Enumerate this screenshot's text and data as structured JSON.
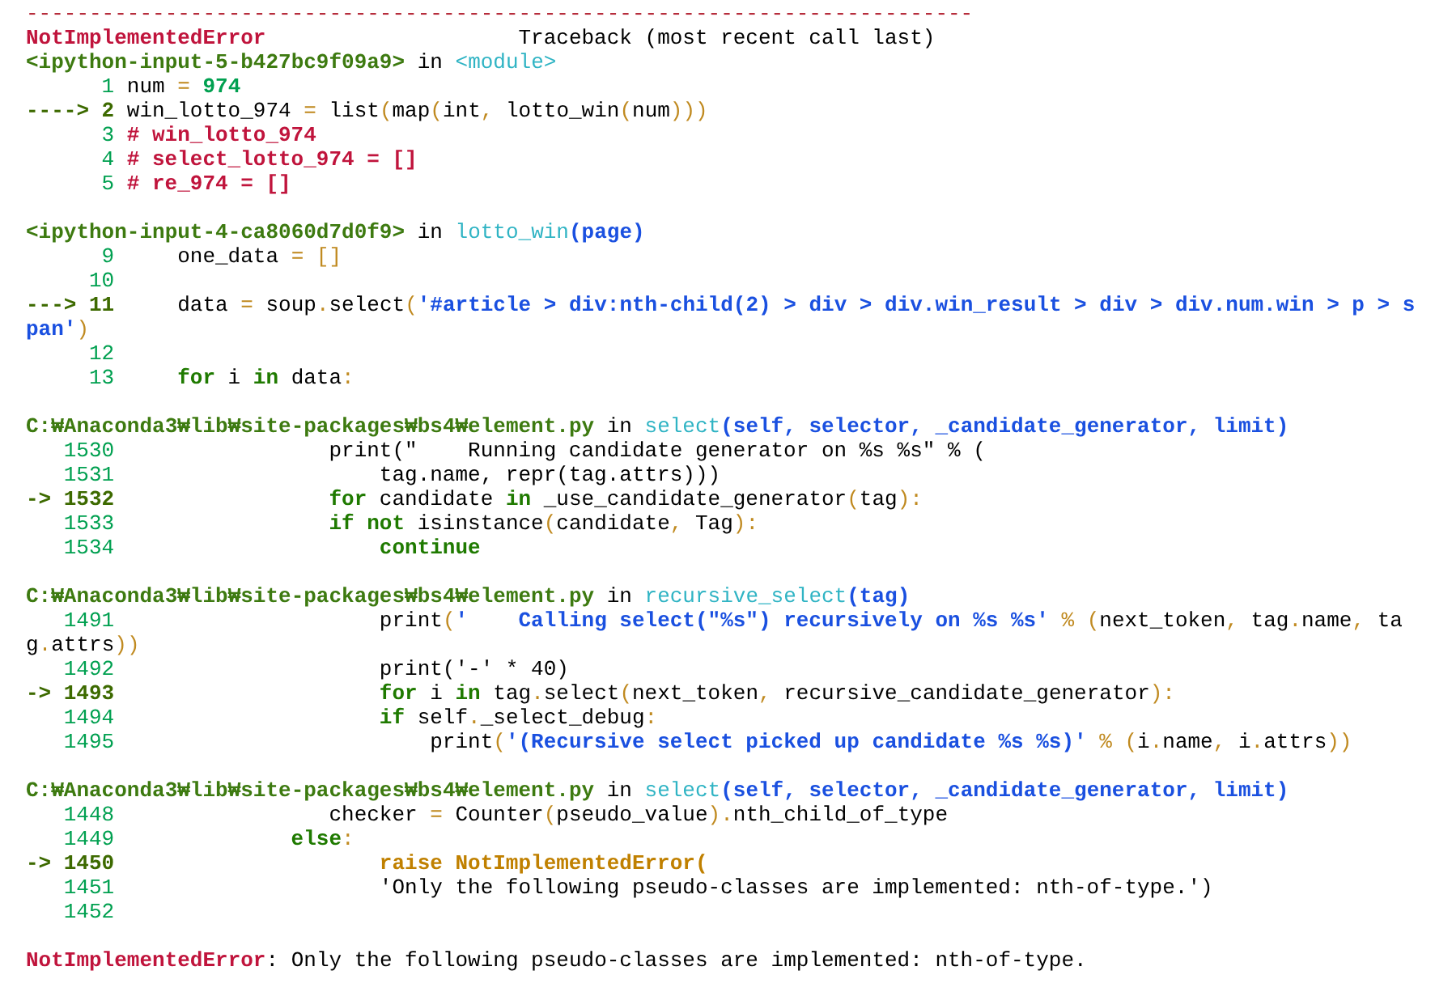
{
  "separator": "---------------------------------------------------------------------------",
  "error_header": {
    "name": "NotImplementedError",
    "traceback": "Traceback (most recent call last)"
  },
  "frames": [
    {
      "location": [
        {
          "kind": "path",
          "text": "<ipython-input-5-b427bc9f09a9>"
        },
        {
          "kind": "plain",
          "text": " in "
        },
        {
          "kind": "name",
          "text": "<module>"
        }
      ],
      "lines": [
        {
          "number": "1",
          "current": false,
          "code": [
            {
              "kind": "plain",
              "text": "num "
            },
            {
              "kind": "op",
              "text": "="
            },
            {
              "kind": "num",
              "text": " 974"
            }
          ]
        },
        {
          "arrow": "---->",
          "number": "2",
          "current": true,
          "code": [
            {
              "kind": "plain",
              "text": "win_lotto_974 "
            },
            {
              "kind": "op",
              "text": "="
            },
            {
              "kind": "plain",
              "text": " list"
            },
            {
              "kind": "op",
              "text": "("
            },
            {
              "kind": "plain",
              "text": "map"
            },
            {
              "kind": "op",
              "text": "("
            },
            {
              "kind": "plain",
              "text": "int"
            },
            {
              "kind": "op",
              "text": ","
            },
            {
              "kind": "plain",
              "text": " lotto_win"
            },
            {
              "kind": "op",
              "text": "("
            },
            {
              "kind": "plain",
              "text": "num"
            },
            {
              "kind": "op",
              "text": ")))"
            }
          ]
        },
        {
          "number": "3",
          "current": false,
          "code": [
            {
              "kind": "comment",
              "text": "# win_lotto_974"
            }
          ]
        },
        {
          "number": "4",
          "current": false,
          "code": [
            {
              "kind": "comment",
              "text": "# select_lotto_974 = []"
            }
          ]
        },
        {
          "number": "5",
          "current": false,
          "code": [
            {
              "kind": "comment",
              "text": "# re_974 = []"
            }
          ]
        }
      ]
    },
    {
      "location": [
        {
          "kind": "path",
          "text": "<ipython-input-4-ca8060d7d0f9>"
        },
        {
          "kind": "plain",
          "text": " in "
        },
        {
          "kind": "name",
          "text": "lotto_win"
        },
        {
          "kind": "args",
          "text": "(page)"
        }
      ],
      "lines": [
        {
          "number": "9",
          "current": false,
          "code": [
            {
              "kind": "plain",
              "text": "    one_data "
            },
            {
              "kind": "op",
              "text": "="
            },
            {
              "kind": "op",
              "text": " []"
            }
          ]
        },
        {
          "number": "10",
          "current": false
        },
        {
          "arrow": "--->",
          "number": "11",
          "current": true,
          "code": [
            {
              "kind": "plain",
              "text": "    data "
            },
            {
              "kind": "op",
              "text": "="
            },
            {
              "kind": "plain",
              "text": " soup"
            },
            {
              "kind": "op",
              "text": "."
            },
            {
              "kind": "plain",
              "text": "select"
            },
            {
              "kind": "op",
              "text": "("
            },
            {
              "kind": "str",
              "text": "'#article > div:nth-child(2) > div > div.win_result > div > div.num.win > p > span'"
            },
            {
              "kind": "op",
              "text": ")"
            }
          ]
        },
        {
          "number": "12",
          "current": false
        },
        {
          "number": "13",
          "current": false,
          "code": [
            {
              "kind": "kw",
              "text": "    for"
            },
            {
              "kind": "plain",
              "text": " i "
            },
            {
              "kind": "kw",
              "text": "in"
            },
            {
              "kind": "plain",
              "text": " data"
            },
            {
              "kind": "op",
              "text": ":"
            }
          ]
        }
      ]
    },
    {
      "location": [
        {
          "kind": "path",
          "text": "C:₩Anaconda3₩lib₩site-packages₩bs4₩element.py"
        },
        {
          "kind": "plain",
          "text": " in "
        },
        {
          "kind": "name",
          "text": "select"
        },
        {
          "kind": "args",
          "text": "(self, selector, _candidate_generator, limit)"
        }
      ],
      "lines": [
        {
          "number": "1530",
          "current": false,
          "code": [
            {
              "kind": "plain",
              "text": "                print(\"    Running candidate generator on %s %s\" % ("
            }
          ]
        },
        {
          "number": "1531",
          "current": false,
          "code": [
            {
              "kind": "plain",
              "text": "                    tag.name, repr(tag.attrs)))"
            }
          ]
        },
        {
          "arrow": "->",
          "number": "1532",
          "current": true,
          "code": [
            {
              "kind": "kw",
              "text": "                for"
            },
            {
              "kind": "plain",
              "text": " candidate "
            },
            {
              "kind": "kw",
              "text": "in"
            },
            {
              "kind": "plain",
              "text": " _use_candidate_generator"
            },
            {
              "kind": "op",
              "text": "("
            },
            {
              "kind": "plain",
              "text": "tag"
            },
            {
              "kind": "op",
              "text": "):"
            }
          ]
        },
        {
          "number": "1533",
          "current": false,
          "code": [
            {
              "kind": "kw",
              "text": "                if not"
            },
            {
              "kind": "plain",
              "text": " isinstance"
            },
            {
              "kind": "op",
              "text": "("
            },
            {
              "kind": "plain",
              "text": "candidate"
            },
            {
              "kind": "op",
              "text": ","
            },
            {
              "kind": "plain",
              "text": " Tag"
            },
            {
              "kind": "op",
              "text": "):"
            }
          ]
        },
        {
          "number": "1534",
          "current": false,
          "code": [
            {
              "kind": "kw",
              "text": "                    continue"
            }
          ]
        }
      ]
    },
    {
      "location": [
        {
          "kind": "path",
          "text": "C:₩Anaconda3₩lib₩site-packages₩bs4₩element.py"
        },
        {
          "kind": "plain",
          "text": " in "
        },
        {
          "kind": "name",
          "text": "recursive_select"
        },
        {
          "kind": "args",
          "text": "(tag)"
        }
      ],
      "lines": [
        {
          "number": "1491",
          "current": false,
          "code": [
            {
              "kind": "plain",
              "text": "                    print"
            },
            {
              "kind": "op",
              "text": "("
            },
            {
              "kind": "str",
              "text": "'    Calling select(\"%s\") recursively on %s %s'"
            },
            {
              "kind": "op",
              "text": " % ("
            },
            {
              "kind": "plain",
              "text": "next_token"
            },
            {
              "kind": "op",
              "text": ","
            },
            {
              "kind": "plain",
              "text": " tag"
            },
            {
              "kind": "op",
              "text": "."
            },
            {
              "kind": "plain",
              "text": "name"
            },
            {
              "kind": "op",
              "text": ","
            },
            {
              "kind": "plain",
              "text": " tag"
            },
            {
              "kind": "op",
              "text": "."
            },
            {
              "kind": "plain",
              "text": "attrs"
            },
            {
              "kind": "op",
              "text": "))"
            }
          ]
        },
        {
          "number": "1492",
          "current": false,
          "code": [
            {
              "kind": "plain",
              "text": "                    print('-' * 40)"
            }
          ]
        },
        {
          "arrow": "->",
          "number": "1493",
          "current": true,
          "code": [
            {
              "kind": "kw",
              "text": "                    for"
            },
            {
              "kind": "plain",
              "text": " i "
            },
            {
              "kind": "kw",
              "text": "in"
            },
            {
              "kind": "plain",
              "text": " tag"
            },
            {
              "kind": "op",
              "text": "."
            },
            {
              "kind": "plain",
              "text": "select"
            },
            {
              "kind": "op",
              "text": "("
            },
            {
              "kind": "plain",
              "text": "next_token"
            },
            {
              "kind": "op",
              "text": ","
            },
            {
              "kind": "plain",
              "text": " recursive_candidate_generator"
            },
            {
              "kind": "op",
              "text": "):"
            }
          ]
        },
        {
          "number": "1494",
          "current": false,
          "code": [
            {
              "kind": "kw",
              "text": "                    if"
            },
            {
              "kind": "plain",
              "text": " self"
            },
            {
              "kind": "op",
              "text": "."
            },
            {
              "kind": "plain",
              "text": "_select_debug"
            },
            {
              "kind": "op",
              "text": ":"
            }
          ]
        },
        {
          "number": "1495",
          "current": false,
          "code": [
            {
              "kind": "plain",
              "text": "                        print"
            },
            {
              "kind": "op",
              "text": "("
            },
            {
              "kind": "str",
              "text": "'(Recursive select picked up candidate %s %s)'"
            },
            {
              "kind": "op",
              "text": " % ("
            },
            {
              "kind": "plain",
              "text": "i"
            },
            {
              "kind": "op",
              "text": "."
            },
            {
              "kind": "plain",
              "text": "name"
            },
            {
              "kind": "op",
              "text": ","
            },
            {
              "kind": "plain",
              "text": " i"
            },
            {
              "kind": "op",
              "text": "."
            },
            {
              "kind": "plain",
              "text": "attrs"
            },
            {
              "kind": "op",
              "text": "))"
            }
          ]
        }
      ]
    },
    {
      "location": [
        {
          "kind": "path",
          "text": "C:₩Anaconda3₩lib₩site-packages₩bs4₩element.py"
        },
        {
          "kind": "plain",
          "text": " in "
        },
        {
          "kind": "name",
          "text": "select"
        },
        {
          "kind": "args",
          "text": "(self, selector, _candidate_generator, limit)"
        }
      ],
      "lines": [
        {
          "number": "1448",
          "current": false,
          "code": [
            {
              "kind": "plain",
              "text": "                checker "
            },
            {
              "kind": "op",
              "text": "="
            },
            {
              "kind": "plain",
              "text": " Counter"
            },
            {
              "kind": "op",
              "text": "("
            },
            {
              "kind": "plain",
              "text": "pseudo_value"
            },
            {
              "kind": "op",
              "text": ")."
            },
            {
              "kind": "plain",
              "text": "nth_child_of_type"
            }
          ]
        },
        {
          "number": "1449",
          "current": false,
          "code": [
            {
              "kind": "kw",
              "text": "             else"
            },
            {
              "kind": "op",
              "text": ":"
            }
          ]
        },
        {
          "arrow": "->",
          "number": "1450",
          "current": true,
          "code": [
            {
              "kind": "raise",
              "text": "                    raise NotImplementedError("
            }
          ]
        },
        {
          "number": "1451",
          "current": false,
          "code": [
            {
              "kind": "plain",
              "text": "                    'Only the following pseudo-classes are implemented: nth-of-type.')"
            }
          ]
        },
        {
          "number": "1452",
          "current": false
        }
      ]
    }
  ],
  "error": {
    "name": "NotImplementedError",
    "message": ": Only the following pseudo-classes are implemented: nth-of-type."
  }
}
